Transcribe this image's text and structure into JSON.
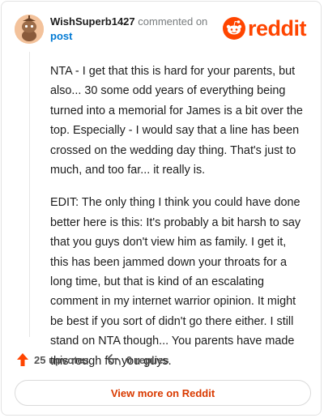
{
  "header": {
    "author": "WishSuperb1427",
    "verb": "commented on",
    "post_link": "post",
    "logo_text": "reddit"
  },
  "comment": {
    "paragraphs": [
      "NTA - I get that this is hard for your parents, but also... 30 some odd years of everything being turned into a memorial for James is a bit over the top. Especially - I would say that a line has been crossed on the wedding day thing. That's just to much, and too far... it really is.",
      "EDIT: The only thing I think you could have done better here is this: It's probably a bit harsh to say that you guys don't view him as family. I get it, this has been jammed down your throats for a long time, but that is kind of an escalating comment in my internet warrior opinion. It might be best if you sort of didn't go there either. I still stand on NTA though... You parents have made this rough for you guys."
    ]
  },
  "actions": {
    "upvotes": "25 upvotes",
    "replies": "0 replies"
  },
  "footer": {
    "view_more": "View more on Reddit"
  },
  "colors": {
    "brand": "#ff4500",
    "link": "#0079d3",
    "upvote": "#ff4500",
    "view_more_text": "#d93a00"
  }
}
